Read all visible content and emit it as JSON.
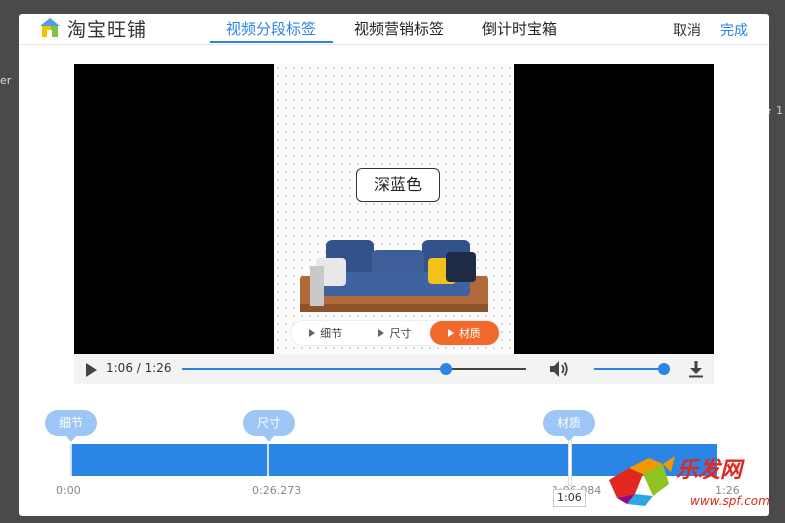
{
  "background": {
    "left_text": "er",
    "right_text": "★ 1"
  },
  "header": {
    "logo_text": "淘宝旺铺",
    "tabs": [
      {
        "label": "视频分段标签",
        "active": true
      },
      {
        "label": "视频营销标签",
        "active": false
      },
      {
        "label": "倒计时宝箱",
        "active": false
      }
    ],
    "cancel_label": "取消",
    "done_label": "完成"
  },
  "video": {
    "color_label": "深蓝色",
    "chips": [
      {
        "label": "细节",
        "active": false
      },
      {
        "label": "尺寸",
        "active": false
      },
      {
        "label": "材质",
        "active": true
      }
    ],
    "time_display": "1:06 / 1:26",
    "progress_fraction": 0.767,
    "volume_fraction": 1.0
  },
  "timeline": {
    "markers": [
      {
        "label": "细节",
        "time_s": 0
      },
      {
        "label": "尺寸",
        "time_s": 26.273
      },
      {
        "label": "材质",
        "time_s": 66
      }
    ],
    "tick_labels": [
      "0:00",
      "0:26.273",
      "1:06.084",
      "1:26"
    ],
    "playhead_tooltip": "1:06",
    "duration_s": 86
  },
  "watermark": {
    "text": "乐发网",
    "url": "www.spf.com"
  },
  "colors": {
    "accent": "#2b85e4",
    "marker": "#9cc6f5",
    "active_chip": "#f26a2b"
  }
}
